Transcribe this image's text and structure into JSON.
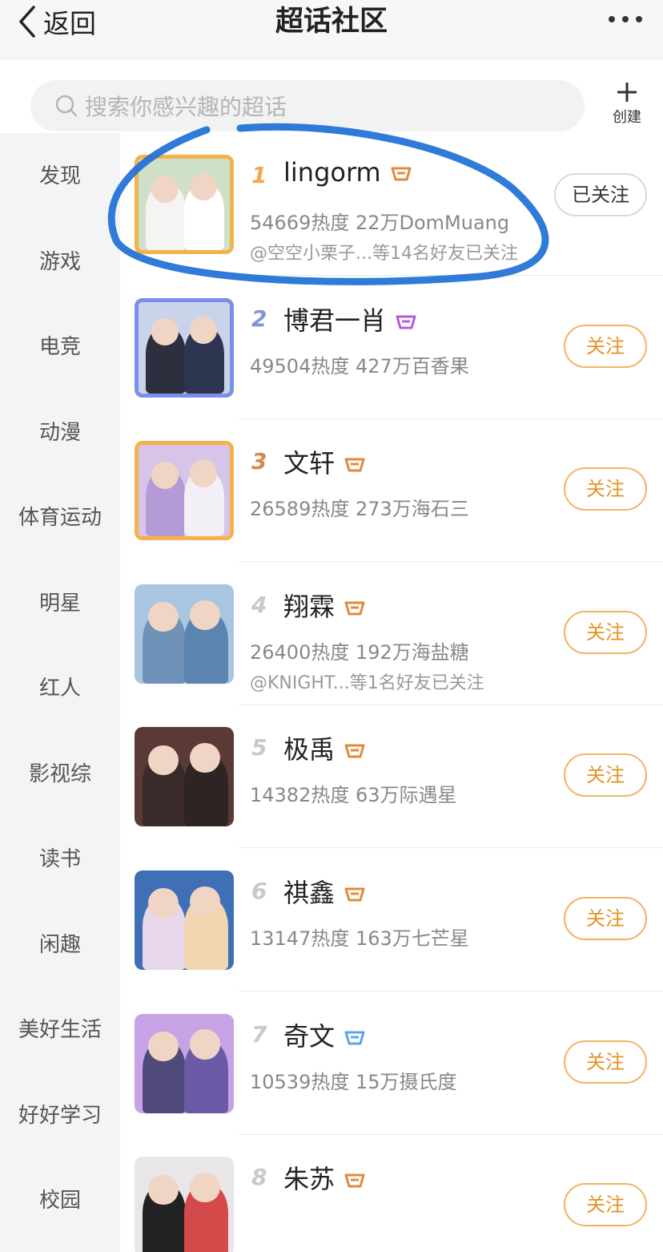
{
  "header": {
    "back_label": "返回",
    "title": "超话社区",
    "more_icon": "more-dots-icon"
  },
  "search": {
    "placeholder": "搜索你感兴趣的超话",
    "create_label": "创建"
  },
  "sidebar": {
    "items": [
      "发现",
      "游戏",
      "电竞",
      "动漫",
      "体育运动",
      "明星",
      "红人",
      "影视综",
      "读书",
      "闲趣",
      "美好生活",
      "好好学习",
      "校园"
    ]
  },
  "list": [
    {
      "rank": "1",
      "name": "lingorm",
      "stats": "54669热度 22万DomMuang",
      "friends": "@空空小栗子...等14名好友已关注",
      "button": "已关注",
      "followed": true,
      "badge_color": "#e08a3c"
    },
    {
      "rank": "2",
      "name": "博君一肖",
      "stats": "49504热度 427万百香果",
      "friends": "",
      "button": "关注",
      "followed": false,
      "badge_color": "#b45bdc"
    },
    {
      "rank": "3",
      "name": "文轩",
      "stats": "26589热度 273万海石三",
      "friends": "",
      "button": "关注",
      "followed": false,
      "badge_color": "#e08a3c"
    },
    {
      "rank": "4",
      "name": "翔霖",
      "stats": "26400热度 192万海盐糖",
      "friends": "@KNIGHT...等1名好友已关注",
      "button": "关注",
      "followed": false,
      "badge_color": "#e08a3c"
    },
    {
      "rank": "5",
      "name": "极禹",
      "stats": "14382热度 63万际遇星",
      "friends": "",
      "button": "关注",
      "followed": false,
      "badge_color": "#e08a3c"
    },
    {
      "rank": "6",
      "name": "祺鑫",
      "stats": "13147热度 163万七芒星",
      "friends": "",
      "button": "关注",
      "followed": false,
      "badge_color": "#e08a3c"
    },
    {
      "rank": "7",
      "name": "奇文",
      "stats": "10539热度 15万摄氏度",
      "friends": "",
      "button": "关注",
      "followed": false,
      "badge_color": "#5aa6e6"
    },
    {
      "rank": "8",
      "name": "朱苏",
      "stats": "",
      "friends": "",
      "button": "关注",
      "followed": false,
      "badge_color": "#e08a3c"
    }
  ],
  "colors": {
    "accent": "#e59225",
    "annotation": "#1e6fd6"
  }
}
